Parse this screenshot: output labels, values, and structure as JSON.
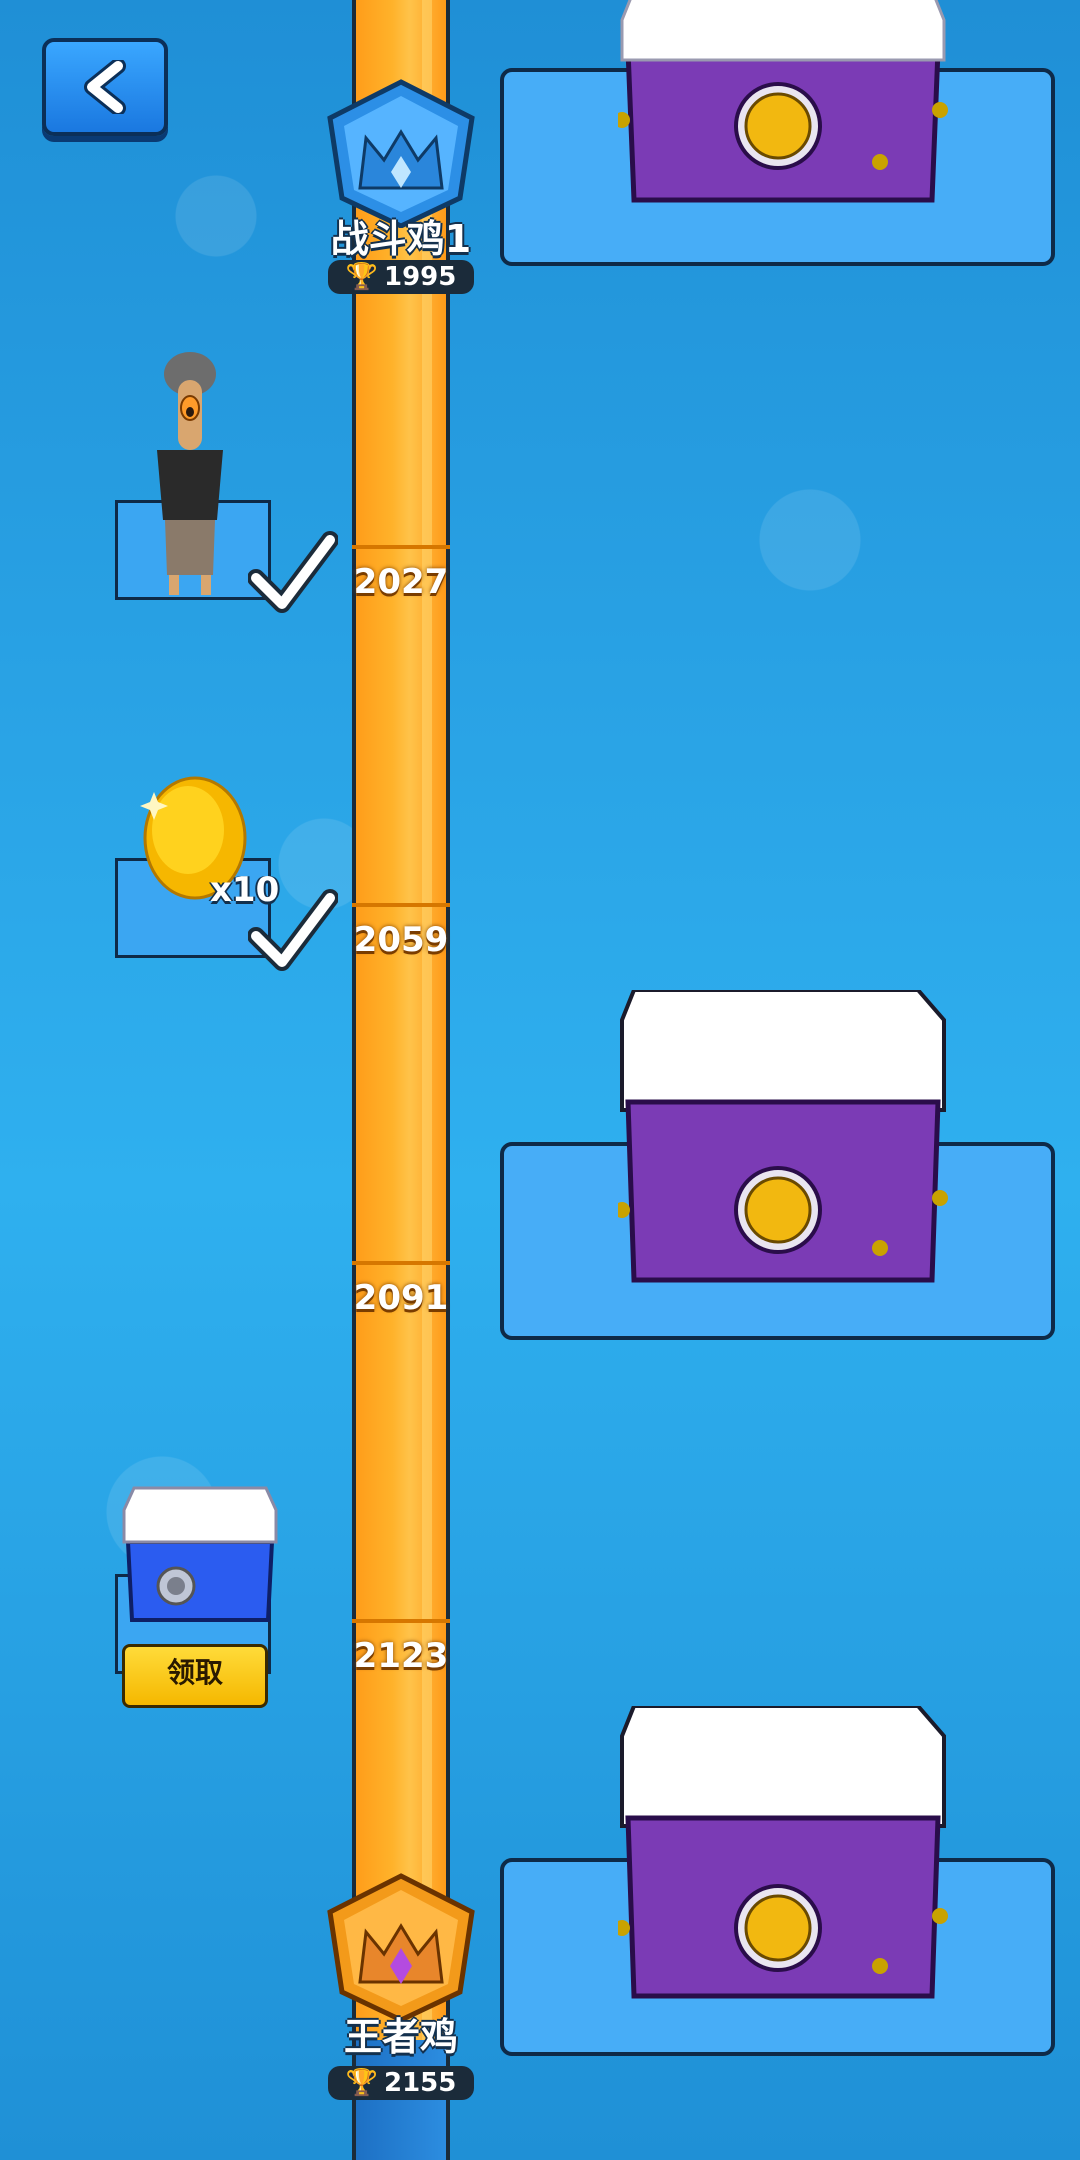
{
  "back_button": {
    "icon": "chevron-left-icon"
  },
  "track": {
    "tick_labels": [
      "2027",
      "2059",
      "2091",
      "2123"
    ]
  },
  "ranks": [
    {
      "name": "战斗鸡1",
      "trophies": "1995",
      "icon": "blue-crown-shield-icon",
      "color": "#2c8fe6"
    },
    {
      "name": "王者鸡",
      "trophies": "2155",
      "icon": "gold-crown-shield-icon",
      "color": "#f39a1a"
    }
  ],
  "rewards_left": [
    {
      "kind": "character",
      "claimed": true
    },
    {
      "kind": "golden-egg",
      "quantity": "x10",
      "claimed": true
    },
    {
      "kind": "blue-chest",
      "claim_label": "领取"
    }
  ],
  "rewards_right": [
    {
      "kind": "purple-chest"
    },
    {
      "kind": "purple-chest"
    },
    {
      "kind": "purple-chest"
    }
  ],
  "colors": {
    "track": "#ffa61f",
    "accent_blue": "#2aa4e6",
    "chest_purple": "#7b3bb5",
    "claim_yellow": "#f5b800"
  }
}
